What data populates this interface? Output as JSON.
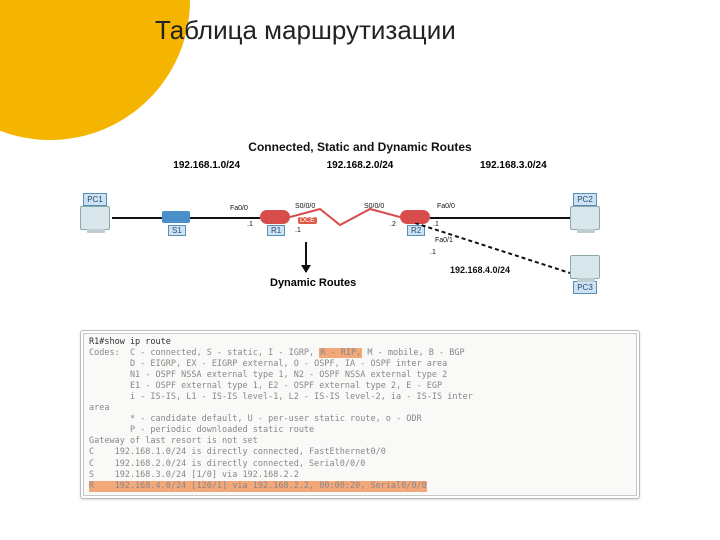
{
  "title": "Таблица маршрутизации",
  "diagram": {
    "heading": "Connected, Static and Dynamic Routes",
    "subnets": [
      "192.168.1.0/24",
      "192.168.2.0/24",
      "192.168.3.0/24"
    ],
    "subnet4": "192.168.4.0/24",
    "pcs": {
      "pc1": "PC1",
      "pc2": "PC2",
      "pc3": "PC3"
    },
    "devices": {
      "s1": "S1",
      "r1": "R1",
      "r2": "R2"
    },
    "ports": {
      "fa00_left": "Fa0/0",
      "p1l": ".1",
      "s000_left": "S0/0/0",
      "s000_right": "S0/0/0",
      "dce": "DCE",
      "p1m": ".1",
      "p2m": ".2",
      "fa00_right": "Fa0/0",
      "p1r": ".1",
      "fa01": "Fa0/1",
      "p1b": ".1"
    },
    "dynroutes": "Dynamic Routes"
  },
  "cli": {
    "cmd": "R1#show ip route",
    "l1a": "Codes:  C - connected, S - static, I - IGRP, ",
    "l1b": "R - RIP,",
    "l1c": " M - mobile, B - BGP",
    "l2": "        D - EIGRP, EX - EIGRP external, O - OSPF, IA - OSPF inter area",
    "l3": "        N1 - OSPF NSSA external type 1, N2 - OSPF NSSA external type 2",
    "l4": "        E1 - OSPF external type 1, E2 - OSPF external type 2, E - EGP",
    "l5": "        i - IS-IS, L1 - IS-IS level-1, L2 - IS-IS level-2, ia - IS-IS inter",
    "l6": "area",
    "l7": "        * - candidate default, U - per-user static route, o - ODR",
    "l8": "        P - periodic downloaded static route",
    "l9": "Gateway of last resort is not set",
    "r1": "C    192.168.1.0/24 is directly connected, FastEthernet0/0",
    "r2": "C    192.168.2.0/24 is directly connected, Serial0/0/0",
    "r3": "S    192.168.3.0/24 [1/0] via 192.168.2.2",
    "r4": "R    192.168.4.0/24 [120/1] via 192.168.2.2, 00:00:20, Serial0/0/0"
  }
}
